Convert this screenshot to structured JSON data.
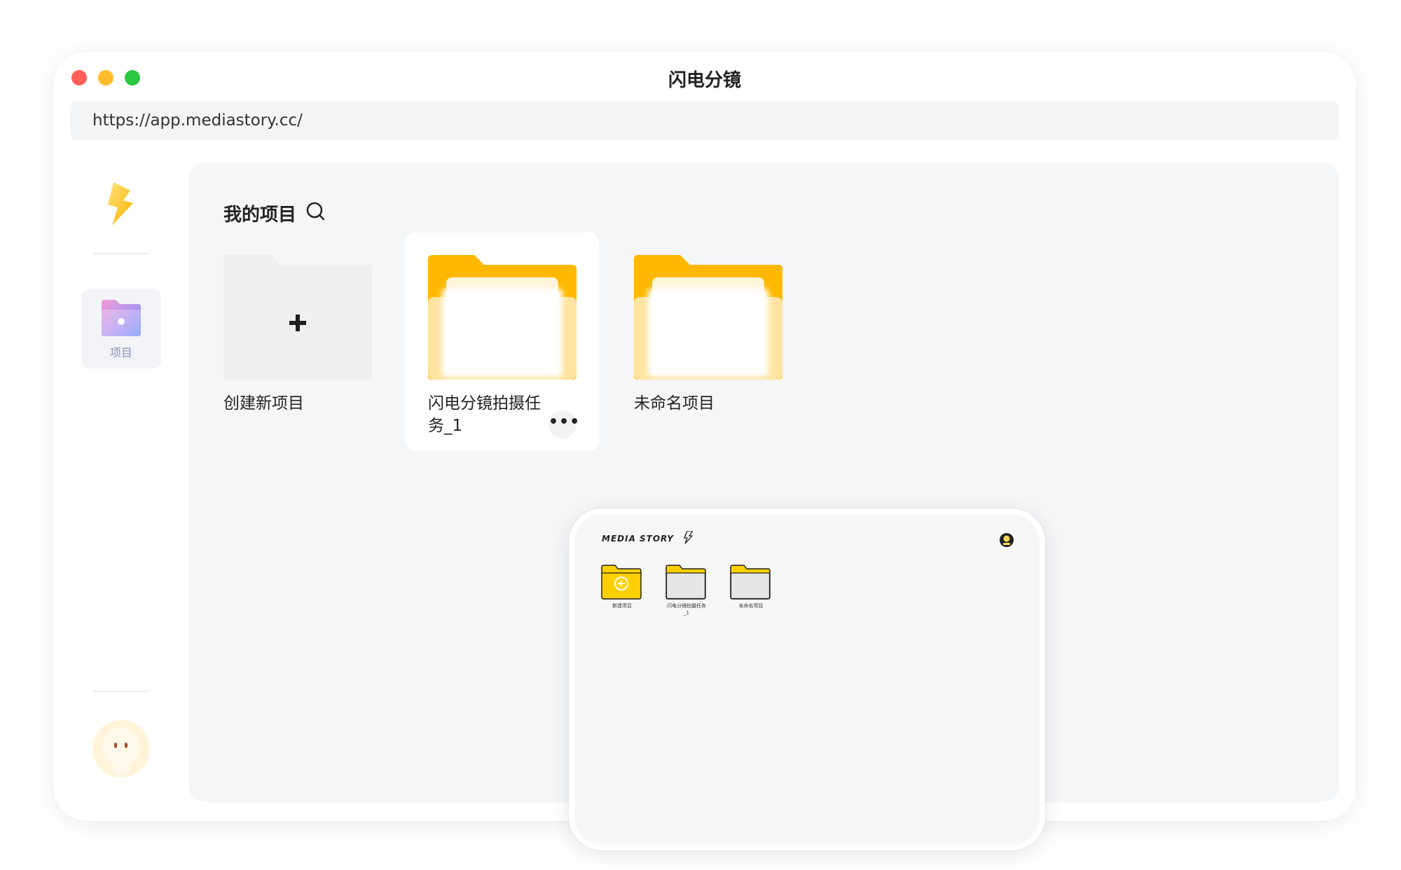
{
  "window": {
    "title": "闪电分镜",
    "url": "https://app.mediastory.cc/"
  },
  "sidebar": {
    "nav_projects_label": "项目"
  },
  "main": {
    "section_title": "我的项目",
    "cards": [
      {
        "name": "创建新项目",
        "type": "create"
      },
      {
        "name": "闪电分镜拍摄任务_1",
        "type": "folder"
      },
      {
        "name": "未命名项目",
        "type": "folder"
      }
    ],
    "more_label": "•••"
  },
  "tablet": {
    "brand": "MEDIA STORY",
    "items": [
      {
        "label": "新建项目"
      },
      {
        "label": "闪电分镜拍摄任务_1"
      },
      {
        "label": "未命名项目"
      }
    ]
  },
  "colors": {
    "accent_yellow": "#ffb800",
    "folder_light": "#ffe3a0",
    "panel_bg": "#f5f6f8"
  }
}
